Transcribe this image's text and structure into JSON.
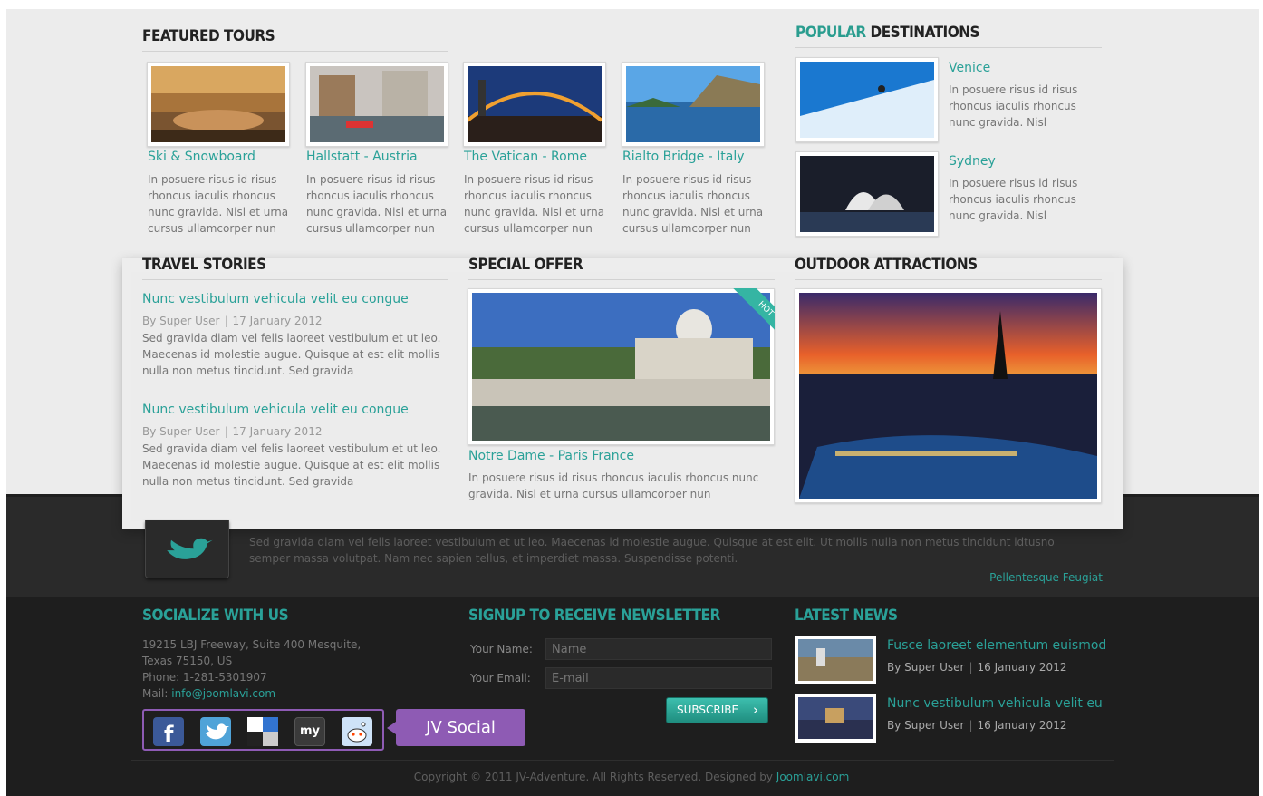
{
  "colors": {
    "accent": "#2aa198",
    "purple": "#8e5bb4",
    "dark": "#1e1e1e"
  },
  "featured": {
    "heading": "FEATURED TOURS",
    "items": [
      {
        "title": "Ski & Snowboard",
        "desc": "In posuere risus id risus rhoncus iaculis rhoncus nunc gravida. Nisl et urna cursus ullamcorper nun"
      },
      {
        "title": "Hallstatt - Austria",
        "desc": "In posuere risus id risus rhoncus iaculis rhoncus nunc gravida. Nisl et urna cursus ullamcorper nun"
      },
      {
        "title": "The Vatican - Rome",
        "desc": "In posuere risus id risus rhoncus iaculis rhoncus nunc gravida. Nisl et urna cursus ullamcorper nun"
      },
      {
        "title": "Rialto Bridge - Italy",
        "desc": "In posuere risus id risus rhoncus iaculis rhoncus nunc gravida. Nisl et urna cursus ullamcorper nun"
      }
    ]
  },
  "popular": {
    "heading_accent": "POPULAR",
    "heading_rest": " DESTINATIONS",
    "items": [
      {
        "title": "Venice",
        "desc": "In posuere risus id risus rhoncus iaculis rhoncus nunc gravida. Nisl"
      },
      {
        "title": "Sydney",
        "desc": "In posuere risus id risus rhoncus iaculis rhoncus nunc gravida. Nisl"
      }
    ]
  },
  "stories": {
    "heading": "TRAVEL STORIES",
    "items": [
      {
        "title": "Nunc vestibulum vehicula velit eu congue",
        "author": "By Super User",
        "date": "17 January 2012",
        "desc": "Sed gravida diam vel felis laoreet vestibulum et ut leo. Maecenas id molestie augue. Quisque at est elit mollis nulla non metus tincidunt. Sed gravida"
      },
      {
        "title": "Nunc vestibulum vehicula velit eu congue",
        "author": "By Super User",
        "date": "17 January 2012",
        "desc": "Sed gravida diam vel felis laoreet vestibulum et ut leo. Maecenas id molestie augue. Quisque at est elit mollis nulla non metus tincidunt. Sed gravida"
      }
    ]
  },
  "special": {
    "heading": "SPECIAL OFFER",
    "badge": "HOT",
    "title": "Notre Dame - Paris France",
    "desc": "In posuere risus id risus rhoncus iaculis rhoncus nunc gravida. Nisl et urna cursus ullamcorper nun"
  },
  "outdoor": {
    "heading": "OUTDOOR ATTRACTIONS"
  },
  "twitter": {
    "text": "Sed gravida diam vel felis laoreet vestibulum et ut leo. Maecenas id molestie augue. Quisque at est elit. Ut mollis nulla non metus tincidunt idtusno semper massa volutpat. Nam nec sapien tellus, et imperdiet massa. Suspendisse potenti.",
    "link": "Pellentesque Feugiat"
  },
  "socialize": {
    "heading": "SOCIALIZE WITH US",
    "address1": "19215 LBJ Freeway, Suite 400 Mesquite,",
    "address2": "Texas 75150, US",
    "phone": "Phone: 1-281-5301907",
    "mail_label": "Mail: ",
    "mail": "info@joomlavi.com",
    "tag": "JV Social",
    "myspace": "my"
  },
  "newsletter": {
    "heading": "SIGNUP TO RECEIVE NEWSLETTER",
    "name_label": "Your Name:",
    "name_placeholder": "Name",
    "email_label": "Your Email:",
    "email_placeholder": "E-mail",
    "button": "SUBSCRIBE"
  },
  "news": {
    "heading": "LATEST NEWS",
    "items": [
      {
        "title": "Fusce laoreet elementum euismod",
        "author": "By Super User",
        "date": "16 January 2012"
      },
      {
        "title": "Nunc vestibulum vehicula velit eu",
        "author": "By Super User",
        "date": "16 January 2012"
      }
    ]
  },
  "copyright": {
    "text": "Copyright © 2011 JV-Adventure. All Rights Reserved. Designed by ",
    "link": "Joomlavi.com"
  }
}
